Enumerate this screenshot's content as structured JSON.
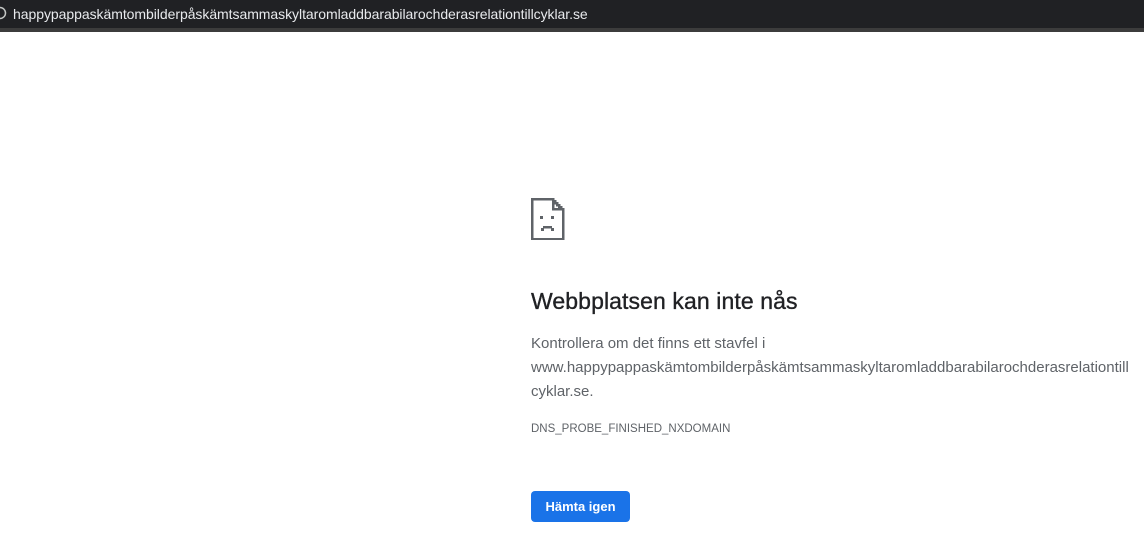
{
  "address_bar": {
    "url": "happypappaskämtombilderpåskämtsammaskyltaromladdbarabilarochderasrelationtillcyklar.se",
    "icon": "info-icon"
  },
  "error_page": {
    "icon": "sad-document-icon",
    "title": "Webbplatsen kan inte nås",
    "description_line1": "Kontrollera om det finns ett stavfel i",
    "description_line2": "www.happypappaskämtombilderpåskämtsammaskyltaromladdbarabilarochderasrelationtill",
    "description_line3": "cyklar.se.",
    "error_code": "DNS_PROBE_FINISHED_NXDOMAIN",
    "reload_button_label": "Hämta igen"
  },
  "colors": {
    "topbar_bg": "#202124",
    "button_bg": "#1a73e8",
    "title_color": "#202124",
    "text_color": "#5f6368"
  }
}
